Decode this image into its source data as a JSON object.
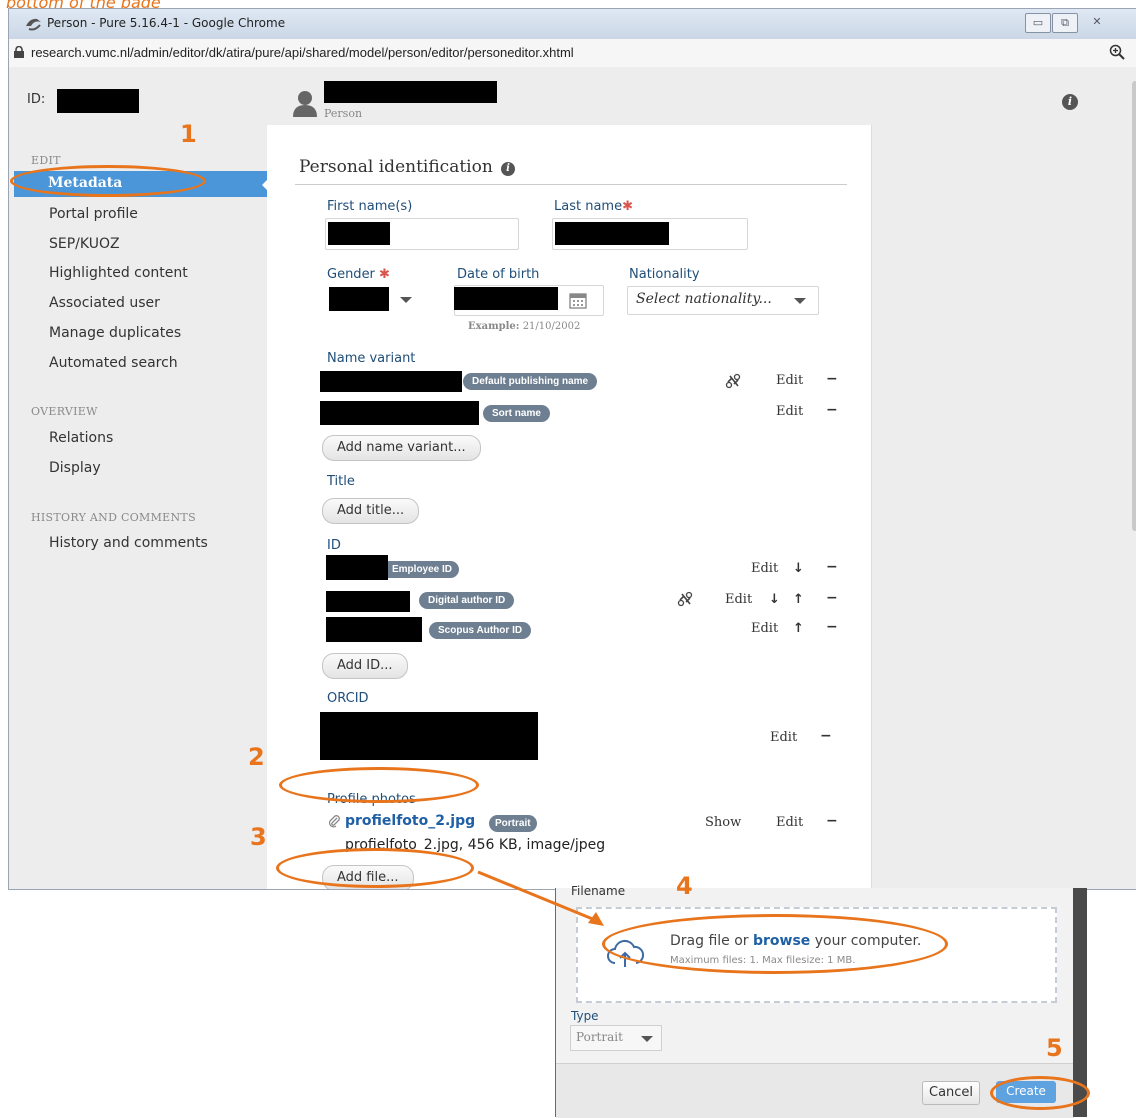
{
  "caption": "bottom of the page",
  "window": {
    "title": "Person - Pure 5.16.4-1 - Google Chrome",
    "url": "research.vumc.nl/admin/editor/dk/atira/pure/api/shared/model/person/editor/personeditor.xhtml",
    "controls": [
      "▭",
      "⧉",
      "✕"
    ]
  },
  "header": {
    "id_label": "ID:",
    "subtitle": "Person",
    "info_glyph": "i"
  },
  "sidebar": {
    "edit_heading": "EDIT",
    "edit_items": [
      "Metadata",
      "Portal profile",
      "SEP/KUOZ",
      "Highlighted content",
      "Associated user",
      "Manage duplicates",
      "Automated search"
    ],
    "overview_heading": "OVERVIEW",
    "overview_items": [
      "Relations",
      "Display"
    ],
    "history_heading": "HISTORY AND COMMENTS",
    "history_items": [
      "History and comments"
    ]
  },
  "form": {
    "section_title": "Personal identification",
    "first_name_label": "First name(s)",
    "last_name_label": "Last name",
    "required_mark": "✱",
    "gender_label": "Gender",
    "dob_label": "Date of birth",
    "dob_example_prefix": "Example:",
    "dob_example": "21/10/2002",
    "nationality_label": "Nationality",
    "nationality_placeholder": "Select nationality...",
    "name_variant_label": "Name variant",
    "name_variants": [
      {
        "chip": "Default publishing name"
      },
      {
        "chip": "Sort name"
      }
    ],
    "add_name_variant": "Add name variant...",
    "title_label": "Title",
    "add_title": "Add title...",
    "id_label": "ID",
    "ids": [
      {
        "chip": "Employee ID"
      },
      {
        "chip": "Digital author ID"
      },
      {
        "chip": "Scopus Author ID"
      }
    ],
    "add_id": "Add ID...",
    "orcid_label": "ORCID",
    "profile_photos_label": "Profile photos",
    "photo_name": "profielfoto_2.jpg",
    "photo_chip": "Portrait",
    "photo_details": "profielfoto_2.jpg, 456 KB, image/jpeg",
    "add_file": "Add file...",
    "edit": "Edit",
    "show": "Show",
    "minus": "−",
    "down": "↓",
    "up": "↑"
  },
  "annotations": [
    "1",
    "2",
    "3",
    "4",
    "5"
  ],
  "dialog": {
    "filename_label": "Filename",
    "drop_prefix": "Drag file or ",
    "drop_link": "browse",
    "drop_suffix": " your computer.",
    "drop_hint": "Maximum files: 1. Max filesize: 1 MB.",
    "type_label": "Type",
    "type_value": "Portrait",
    "cancel": "Cancel",
    "create": "Create"
  },
  "colors": {
    "accent": "#4a96d8",
    "annotation": "#e8741c",
    "chip": "#6e7f91",
    "label": "#1f4e79"
  }
}
